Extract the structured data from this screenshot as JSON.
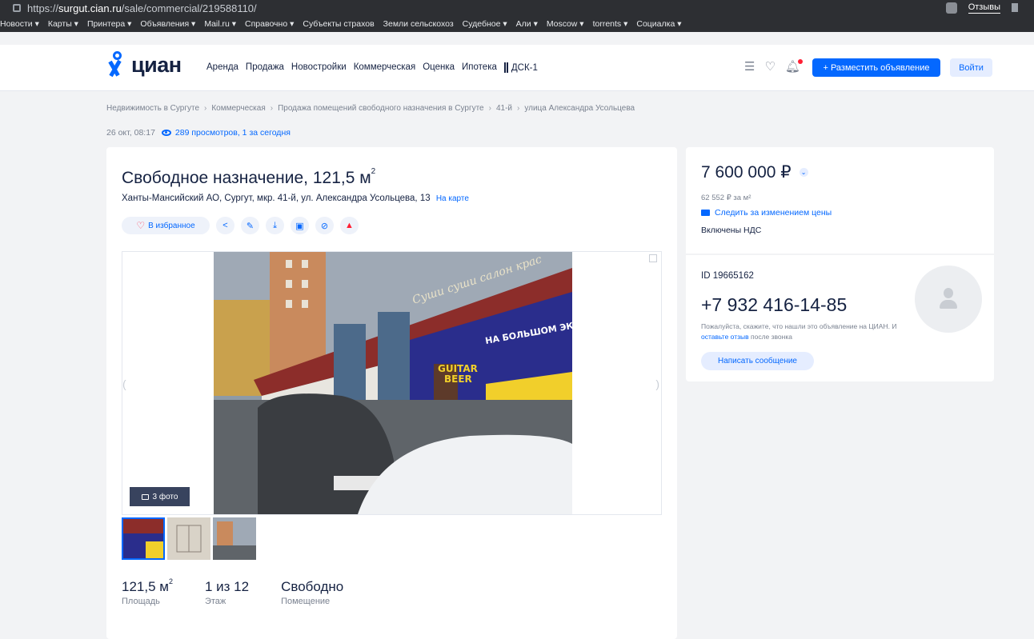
{
  "browser": {
    "url_prefix": "https://",
    "url_domain": "surgut.cian.ru",
    "url_path": "/sale/commercial/219588110/",
    "reviews_label": "Отзывы"
  },
  "bookmarks": [
    "Новости ▾",
    "Карты ▾",
    "Принтера ▾",
    "Объявления ▾",
    "Mail.ru ▾",
    "Справочно ▾",
    "Субъекты страхов",
    "Земли сельскохоз",
    "Судебное ▾",
    "Али ▾",
    "Moscow ▾",
    "torrents ▾",
    "Социалка ▾"
  ],
  "header": {
    "logo": "циан",
    "nav": [
      "Аренда",
      "Продажа",
      "Новостройки",
      "Коммерческая",
      "Оценка",
      "Ипотека"
    ],
    "dsk": "ДСК-1",
    "post_button": "+ Разместить объявление",
    "login_button": "Войти"
  },
  "breadcrumb": [
    "Недвижимость в Сургуте",
    "Коммерческая",
    "Продажа помещений свободного назначения в Сургуте",
    "41-й",
    "улица Александра Усольцева"
  ],
  "meta": {
    "date": "26 окт, 08:17",
    "views": "289 просмотров, 1 за сегодня"
  },
  "listing": {
    "title": "Свободное назначение, 121,5 м",
    "title_sup": "2",
    "address": "Ханты-Мансийский АО, Сургут, мкр. 41-й, ул. Александра Усольцева, 13",
    "map_link": "На карте",
    "favorite_label": "В избранное",
    "photo_count": "3 фото",
    "photo_texts": {
      "sign": "Суши суши салон крас",
      "banner_top": "НА БОЛЬШОМ ЭКРАНЕ",
      "banner_guitar": "GUITAR",
      "banner_beer": "BEER"
    },
    "facts": [
      {
        "value": "121,5 м",
        "sup": "2",
        "label": "Площадь"
      },
      {
        "value": "1 из 12",
        "sup": "",
        "label": "Этаж"
      },
      {
        "value": "Свободно",
        "sup": "",
        "label": "Помещение"
      }
    ]
  },
  "price": {
    "value": "7 600 000 ₽",
    "per_meter": "62 552 ₽ за м²",
    "watch": "Следить за изменением цены",
    "vat": "Включены НДС"
  },
  "contact": {
    "id": "ID 19665162",
    "phone": "+7 932 416-14-85",
    "note_before": "Пожалуйста, скажите, что нашли это объявление на ЦИАН. И ",
    "note_link": "оставьте отзыв",
    "note_after": " после звонка",
    "message_button": "Написать сообщение"
  }
}
